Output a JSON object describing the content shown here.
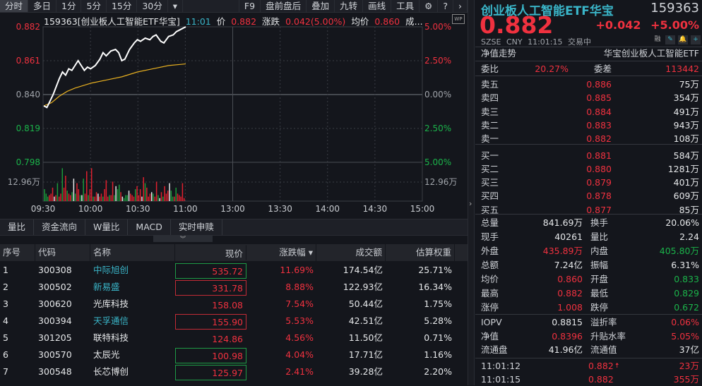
{
  "toolbar": {
    "tabs": [
      "分时",
      "多日",
      "1分",
      "5分",
      "15分",
      "30分",
      "▾"
    ],
    "right": [
      "F9",
      "盘前盘后",
      "叠加",
      "九转",
      "画线",
      "工具",
      "⚙",
      "?",
      "›"
    ]
  },
  "info": {
    "title": "159363[创业板人工智能ETF华宝]",
    "time": "11:01",
    "price_label": "价",
    "price": "0.882",
    "chg_label": "涨跌",
    "chg": "0.042(5.00%)",
    "avg_label": "均价",
    "avg": "0.860",
    "more": "成...",
    "wp": "WP"
  },
  "chart_data": {
    "type": "line",
    "times": [
      "09:30",
      "10:00",
      "10:30",
      "11:00",
      "13:00",
      "13:30",
      "14:00",
      "14:30",
      "15:00"
    ],
    "left_ticks": [
      "0.882",
      "0.861",
      "0.840",
      "0.819",
      "0.798"
    ],
    "right_ticks": [
      "5.00%",
      "2.50%",
      "0.00%",
      "2.50%",
      "5.00%"
    ],
    "ylim": [
      0.798,
      0.882
    ],
    "prev_close": 0.84,
    "vol_label": "12.96万",
    "vol_label_value": 12.96,
    "price_minutes": [
      0,
      2,
      4,
      6,
      8,
      10,
      12,
      14,
      16,
      18,
      20,
      22,
      24,
      26,
      28,
      30,
      33,
      36,
      38,
      40,
      43,
      46,
      48,
      50,
      52,
      55,
      58,
      60,
      62,
      65,
      68,
      70,
      72,
      75,
      77,
      80,
      83,
      85,
      87,
      89,
      91
    ],
    "price": [
      0.833,
      0.832,
      0.836,
      0.84,
      0.845,
      0.85,
      0.854,
      0.852,
      0.856,
      0.855,
      0.858,
      0.861,
      0.858,
      0.855,
      0.857,
      0.856,
      0.858,
      0.862,
      0.866,
      0.864,
      0.867,
      0.868,
      0.866,
      0.861,
      0.862,
      0.868,
      0.872,
      0.874,
      0.873,
      0.875,
      0.874,
      0.876,
      0.877,
      0.873,
      0.872,
      0.876,
      0.877,
      0.879,
      0.88,
      0.881,
      0.882
    ],
    "avg_minutes": [
      0,
      5,
      10,
      15,
      20,
      30,
      40,
      50,
      60,
      70,
      80,
      91
    ],
    "avg": [
      0.833,
      0.835,
      0.839,
      0.842,
      0.844,
      0.847,
      0.849,
      0.851,
      0.854,
      0.856,
      0.858,
      0.859
    ],
    "volume": [
      8,
      5,
      3,
      4,
      5,
      9,
      3,
      4,
      12,
      3,
      5,
      22,
      9,
      17,
      7,
      5,
      4,
      6,
      15,
      5,
      12,
      8,
      4,
      4,
      15,
      5,
      20,
      4,
      8,
      22,
      3,
      3,
      6,
      5,
      3,
      5,
      3,
      8,
      14,
      3,
      4,
      4,
      13,
      4,
      10,
      8,
      11,
      6,
      3,
      2,
      4,
      4,
      7,
      5,
      4,
      3,
      8,
      10,
      4,
      8,
      3,
      16,
      12,
      9,
      3,
      5,
      6,
      5,
      3,
      13,
      4,
      2,
      6,
      3,
      10,
      5,
      7,
      12,
      7,
      3,
      3,
      9,
      5,
      4,
      3,
      12,
      2
    ],
    "volume_colors": "gggrrrwrgrrgrrgrrgwgrrgwgrrgrrgrrwrrgrrrgrrgwggrwgggwrrrgrrrwrgrrrwgrrgwrgrrrwggrgrrrr"
  },
  "tabs": [
    "量比",
    "资金流向",
    "W量比",
    "MACD",
    "实时申赎"
  ],
  "collapse": "︾",
  "table": {
    "headers": [
      "序号",
      "代码",
      "名称",
      "现价",
      "涨跌幅 ▾",
      "成交额",
      "估算权重"
    ],
    "rows": [
      {
        "no": "1",
        "code": "300308",
        "name": "中际旭创",
        "price": "535.72",
        "chg": "11.69%",
        "amount": "174.54亿",
        "weight": "25.71%",
        "box": "green",
        "hl": true
      },
      {
        "no": "2",
        "code": "300502",
        "name": "新易盛",
        "price": "331.78",
        "chg": "8.88%",
        "amount": "122.93亿",
        "weight": "16.34%",
        "box": "red",
        "hl": true
      },
      {
        "no": "3",
        "code": "300620",
        "name": "光库科技",
        "price": "158.08",
        "chg": "7.54%",
        "amount": "50.44亿",
        "weight": "1.75%",
        "box": "",
        "hl": false
      },
      {
        "no": "4",
        "code": "300394",
        "name": "天孚通信",
        "price": "155.90",
        "chg": "5.53%",
        "amount": "42.51亿",
        "weight": "5.28%",
        "box": "red",
        "hl": true
      },
      {
        "no": "5",
        "code": "301205",
        "name": "联特科技",
        "price": "124.86",
        "chg": "4.56%",
        "amount": "11.50亿",
        "weight": "0.71%",
        "box": "",
        "hl": false
      },
      {
        "no": "6",
        "code": "300570",
        "name": "太辰光",
        "price": "100.98",
        "chg": "4.04%",
        "amount": "17.71亿",
        "weight": "1.16%",
        "box": "green",
        "hl": false
      },
      {
        "no": "7",
        "code": "300548",
        "name": "长芯博创",
        "price": "125.97",
        "chg": "2.41%",
        "amount": "39.28亿",
        "weight": "2.20%",
        "box": "green",
        "hl": false
      }
    ]
  },
  "right": {
    "name": "创业板人工智能ETF华宝",
    "code": "159363",
    "price": "0.882",
    "chg": "+0.042",
    "pct": "+5.00%",
    "meta": "SZSE  CNY  11:01:15  交易中",
    "icons": [
      "融",
      "✎",
      "🔔",
      "+"
    ],
    "nav_trend": "净值走势",
    "fund_name": "华宝创业板人工智能ETF",
    "weibi_label": "委比",
    "weibi": "20.27%",
    "weicha_label": "委差",
    "weicha": "113442",
    "asks": [
      {
        "l": "卖五",
        "p": "0.886",
        "v": "75万"
      },
      {
        "l": "卖四",
        "p": "0.885",
        "v": "354万"
      },
      {
        "l": "卖三",
        "p": "0.884",
        "v": "491万"
      },
      {
        "l": "卖二",
        "p": "0.883",
        "v": "943万"
      },
      {
        "l": "卖一",
        "p": "0.882",
        "v": "108万"
      }
    ],
    "bids": [
      {
        "l": "买一",
        "p": "0.881",
        "v": "584万"
      },
      {
        "l": "买二",
        "p": "0.880",
        "v": "1281万"
      },
      {
        "l": "买三",
        "p": "0.879",
        "v": "401万"
      },
      {
        "l": "买四",
        "p": "0.878",
        "v": "609万"
      },
      {
        "l": "买五",
        "p": "0.877",
        "v": "85万"
      }
    ],
    "stats": [
      {
        "k1": "总量",
        "v1": "841.69万",
        "c1": "white",
        "k2": "换手",
        "v2": "20.06%",
        "c2": "white"
      },
      {
        "k1": "现手",
        "v1": "40261",
        "c1": "white",
        "k2": "量比",
        "v2": "2.24",
        "c2": "white"
      },
      {
        "k1": "外盘",
        "v1": "435.89万",
        "c1": "red",
        "k2": "内盘",
        "v2": "405.80万",
        "c2": "green"
      },
      {
        "k1": "总额",
        "v1": "7.24亿",
        "c1": "white",
        "k2": "振幅",
        "v2": "6.31%",
        "c2": "white"
      },
      {
        "k1": "均价",
        "v1": "0.860",
        "c1": "red",
        "k2": "开盘",
        "v2": "0.833",
        "c2": "green"
      },
      {
        "k1": "最高",
        "v1": "0.882",
        "c1": "red",
        "k2": "最低",
        "v2": "0.829",
        "c2": "green"
      },
      {
        "k1": "涨停",
        "v1": "1.008",
        "c1": "red",
        "k2": "跌停",
        "v2": "0.672",
        "c2": "green"
      }
    ],
    "stats2": [
      {
        "k1": "IOPV",
        "v1": "0.8815",
        "c1": "white",
        "k2": "溢折率",
        "v2": "0.06%",
        "c2": "red"
      },
      {
        "k1": "净值",
        "v1": "0.8396",
        "c1": "red",
        "k2": "升贴水率",
        "v2": "5.05%",
        "c2": "red"
      },
      {
        "k1": "流通盘",
        "v1": "41.96亿",
        "c1": "white",
        "k2": "流通值",
        "v2": "37亿",
        "c2": "white"
      }
    ],
    "ticks": [
      {
        "t": "11:01:12",
        "p": "0.882",
        "arrow": "🠅",
        "v": "23万"
      },
      {
        "t": "11:01:15",
        "p": "0.882",
        "arrow": "",
        "v": "355万"
      }
    ]
  }
}
